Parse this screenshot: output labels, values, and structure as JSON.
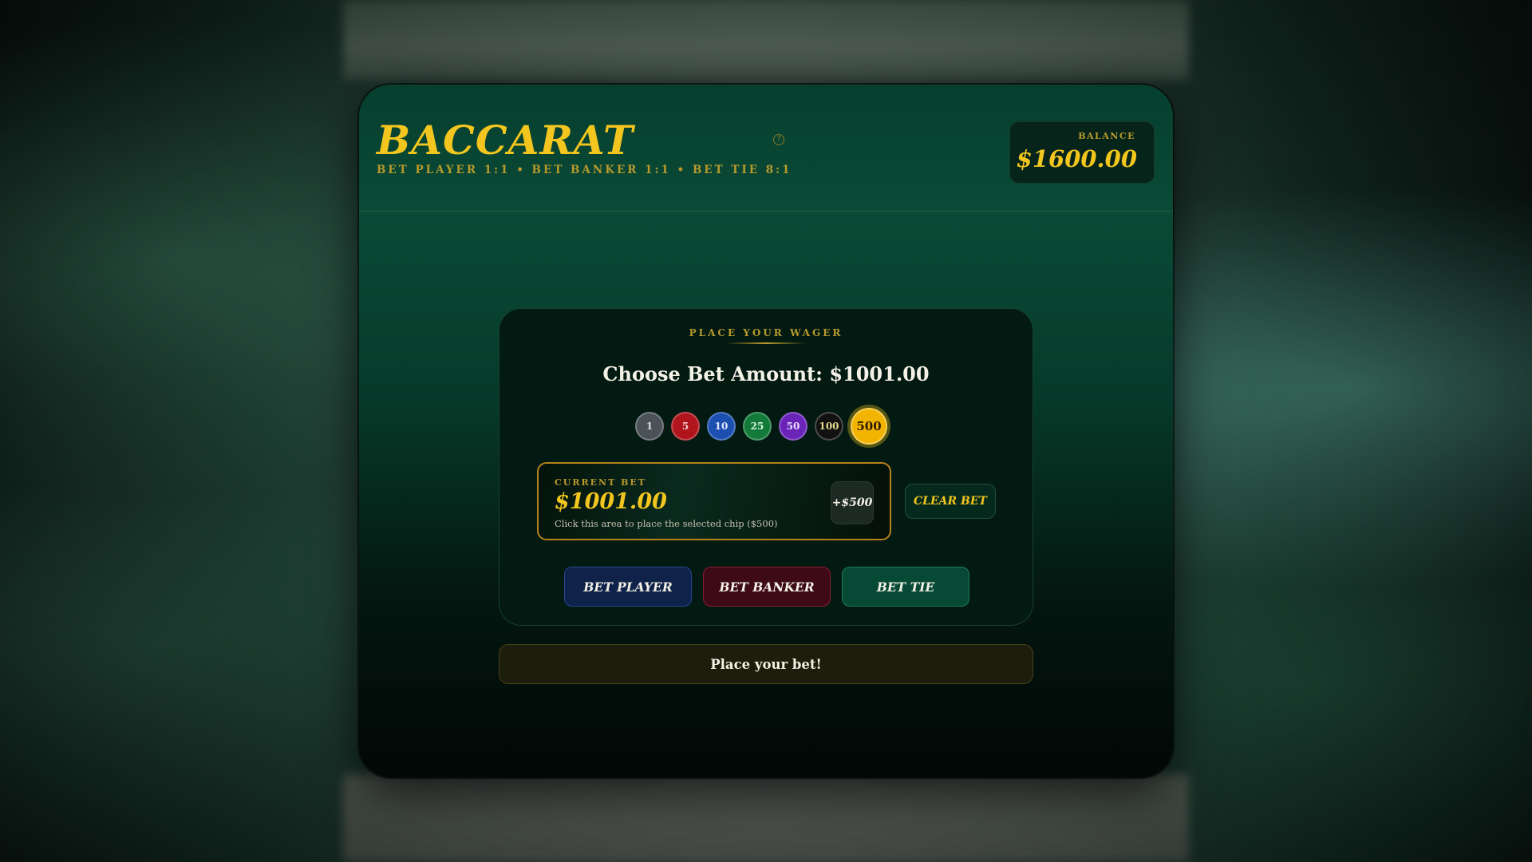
{
  "header": {
    "title": "BACCARAT",
    "subtitle": "BET PLAYER 1:1 • BET BANKER 1:1 • BET TIE 8:1",
    "help_icon": "question-circle-icon",
    "balance_label": "BALANCE",
    "balance_value": "$1600.00"
  },
  "wager": {
    "section_label": "PLACE YOUR WAGER",
    "choose_amount": "Choose Bet Amount: $1001.00",
    "chips": [
      {
        "label": "1",
        "color": "#4a5258",
        "text_color": "#d8dde0"
      },
      {
        "label": "5",
        "color": "#b0141c",
        "text_color": "#f4d0d0"
      },
      {
        "label": "10",
        "color": "#1d4fb0",
        "text_color": "#dfe8ff"
      },
      {
        "label": "25",
        "color": "#137a3a",
        "text_color": "#d8f4e0"
      },
      {
        "label": "50",
        "color": "#6a25b8",
        "text_color": "#eadcff"
      },
      {
        "label": "100",
        "color": "#111111",
        "text_color": "#e8d890"
      },
      {
        "label": "500",
        "color": "#f2b400",
        "text_color": "#2a1c00",
        "selected": true
      }
    ],
    "current_bet": {
      "label": "CURRENT BET",
      "value": "$1001.00",
      "hint": "Click this area to place the selected chip ($500)",
      "add_label": "+$500"
    },
    "clear_bet_label": "CLEAR BET",
    "bet_buttons": {
      "player": "BET PLAYER",
      "banker": "BET BANKER",
      "tie": "BET TIE"
    }
  },
  "status": {
    "message": "Place your bet!"
  },
  "colors": {
    "gold": "#f2c61e",
    "gold_muted": "#b89a2c",
    "felt_green": "#063f2e"
  }
}
